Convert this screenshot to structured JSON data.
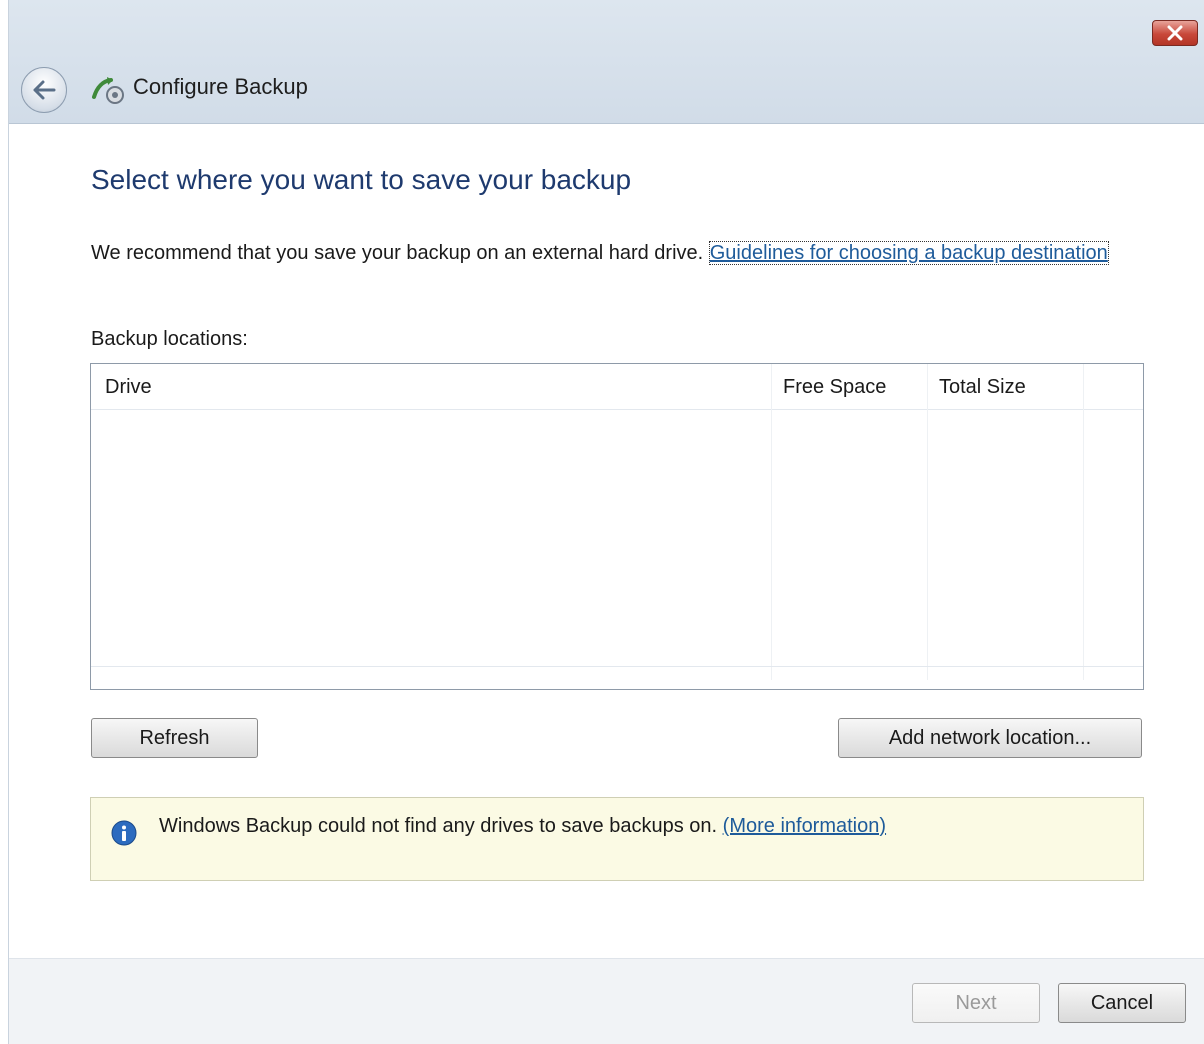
{
  "window": {
    "title": "Configure Backup",
    "close_icon": "close-icon",
    "back_icon": "back-arrow-icon",
    "app_icon": "backup-icon"
  },
  "page": {
    "heading": "Select where you want to save your backup",
    "recommend_text": "We recommend that you save your backup on an external hard drive. ",
    "guidelines_link": "Guidelines for choosing a backup destination",
    "locations_label": "Backup locations:"
  },
  "table": {
    "columns": [
      "Drive",
      "Free Space",
      "Total Size"
    ],
    "rows": []
  },
  "buttons": {
    "refresh": "Refresh",
    "add_network": "Add network location...",
    "next": "Next",
    "cancel": "Cancel"
  },
  "info": {
    "icon": "info-icon",
    "message": "Windows Backup could not find any drives to save backups on. ",
    "more_link": "(More information)"
  },
  "colors": {
    "heading": "#1e3a6e",
    "link": "#1e5b9a",
    "info_background": "#fbfae4",
    "close_button": "#c8483a"
  }
}
